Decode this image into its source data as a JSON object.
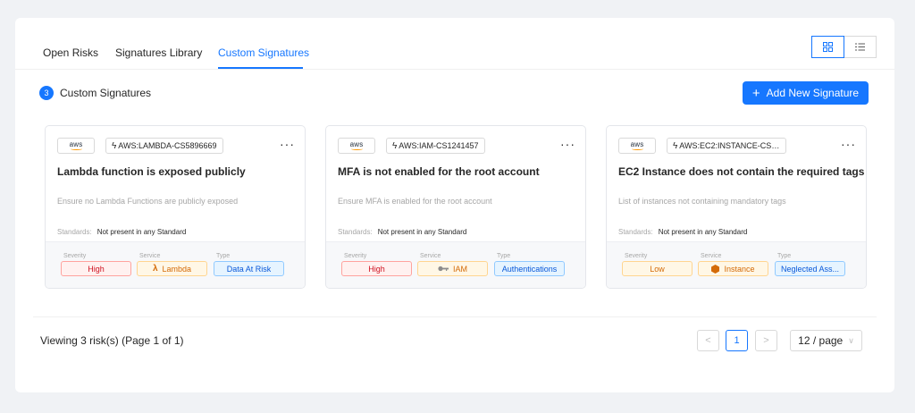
{
  "tabs": [
    {
      "label": "Open Risks",
      "active": false
    },
    {
      "label": "Signatures Library",
      "active": false
    },
    {
      "label": "Custom Signatures",
      "active": true
    }
  ],
  "view_toggle": {
    "grid_icon": "grid-view-icon",
    "list_icon": "list-view-icon",
    "selected": "grid"
  },
  "summary": {
    "count": "3",
    "label": "Custom Signatures"
  },
  "add_button": {
    "icon": "plus-icon",
    "label": "Add New Signature"
  },
  "cards": [
    {
      "provider_logo": "aws",
      "signature_id": "AWS:LAMBDA-CS5896669",
      "title": "Lambda function is exposed publicly",
      "description": "Ensure no Lambda Functions are publicly exposed",
      "standards_label": "Standards:",
      "standards_value": "Not present in any Standard",
      "severity_label": "Severity",
      "severity": "High",
      "service_label": "Service",
      "service": "Lambda",
      "service_icon": "lambda-icon",
      "type_label": "Type",
      "type": "Data At Risk"
    },
    {
      "provider_logo": "aws",
      "signature_id": "AWS:IAM-CS1241457",
      "title": "MFA is not enabled for the root account",
      "description": "Ensure MFA is enabled for the root account",
      "standards_label": "Standards:",
      "standards_value": "Not present in any Standard",
      "severity_label": "Severity",
      "severity": "High",
      "service_label": "Service",
      "service": "IAM",
      "service_icon": "key-icon",
      "type_label": "Type",
      "type": "Authentications"
    },
    {
      "provider_logo": "aws",
      "signature_id": "AWS:EC2:INSTANCE-CS1...",
      "title": "EC2 Instance does not contain the required tags",
      "description": "List of instances not containing mandatory tags",
      "standards_label": "Standards:",
      "standards_value": "Not present in any Standard",
      "severity_label": "Severity",
      "severity": "Low",
      "service_label": "Service",
      "service": "Instance",
      "service_icon": "instance-icon",
      "type_label": "Type",
      "type": "Neglected Ass..."
    }
  ],
  "footer": {
    "viewing_text": "Viewing 3 risk(s) (Page 1 of 1)",
    "pagination": {
      "prev": "<",
      "current": "1",
      "next": ">"
    },
    "page_size": "12 / page"
  }
}
